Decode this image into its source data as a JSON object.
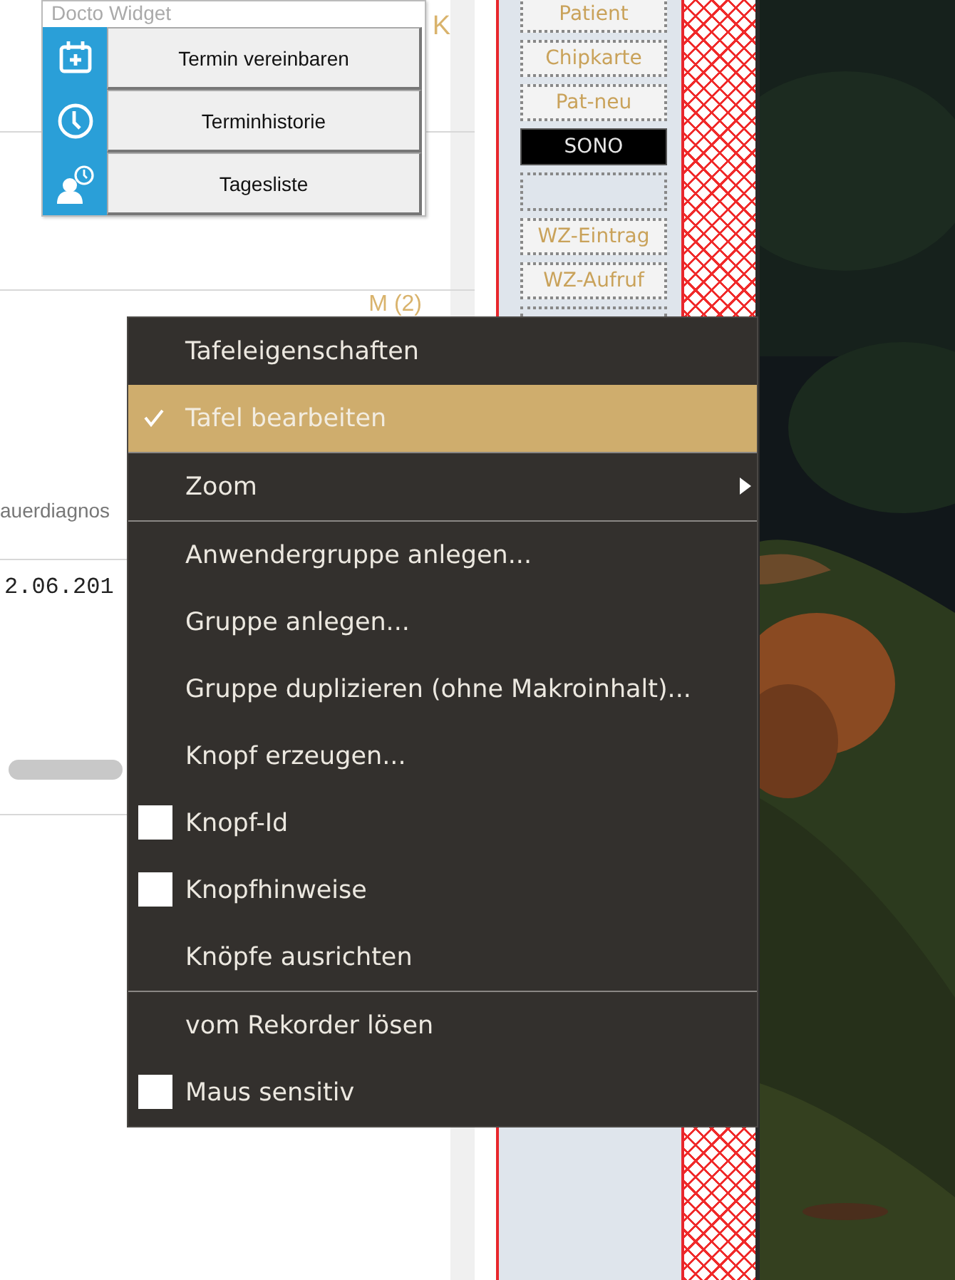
{
  "widget": {
    "title": "Docto Widget",
    "buttons": [
      {
        "label": "Termin vereinbaren"
      },
      {
        "label": "Terminhistorie"
      },
      {
        "label": "Tagesliste"
      }
    ]
  },
  "left_pane": {
    "fragment_top": "K",
    "fragment_mid": "M (2)",
    "column_header": "auerdiagnos",
    "date_cell": "2.06.201"
  },
  "button_panel": [
    {
      "kind": "button",
      "label": "Patient",
      "selected": false
    },
    {
      "kind": "button",
      "label": "Chipkarte",
      "selected": false
    },
    {
      "kind": "button",
      "label": "Pat-neu",
      "selected": false
    },
    {
      "kind": "button",
      "label": "SONO",
      "selected": true
    },
    {
      "kind": "empty"
    },
    {
      "kind": "button",
      "label": "WZ-Eintrag",
      "selected": false
    },
    {
      "kind": "button",
      "label": "WZ-Aufruf",
      "selected": false
    },
    {
      "kind": "empty"
    }
  ],
  "context_menu": {
    "items": [
      {
        "kind": "plain",
        "label": "Tafeleigenschaften",
        "selected": false
      },
      {
        "kind": "check",
        "label": "Tafel bearbeiten",
        "checked": true,
        "selected": true
      },
      {
        "kind": "separator"
      },
      {
        "kind": "submenu",
        "label": "Zoom",
        "selected": false
      },
      {
        "kind": "separator"
      },
      {
        "kind": "plain",
        "label": "Anwendergruppe anlegen...",
        "selected": false
      },
      {
        "kind": "plain",
        "label": "Gruppe anlegen...",
        "selected": false
      },
      {
        "kind": "plain",
        "label": "Gruppe duplizieren (ohne Makroinhalt)...",
        "selected": false
      },
      {
        "kind": "plain",
        "label": "Knopf erzeugen...",
        "selected": false
      },
      {
        "kind": "check",
        "label": "Knopf-Id",
        "checked": false,
        "selected": false
      },
      {
        "kind": "check",
        "label": "Knopfhinweise",
        "checked": false,
        "selected": false
      },
      {
        "kind": "plain",
        "label": "Knöpfe ausrichten",
        "selected": false
      },
      {
        "kind": "separator"
      },
      {
        "kind": "plain",
        "label": "vom Rekorder lösen",
        "selected": false
      },
      {
        "kind": "check",
        "label": "Maus sensitiv",
        "checked": false,
        "selected": false
      }
    ]
  }
}
